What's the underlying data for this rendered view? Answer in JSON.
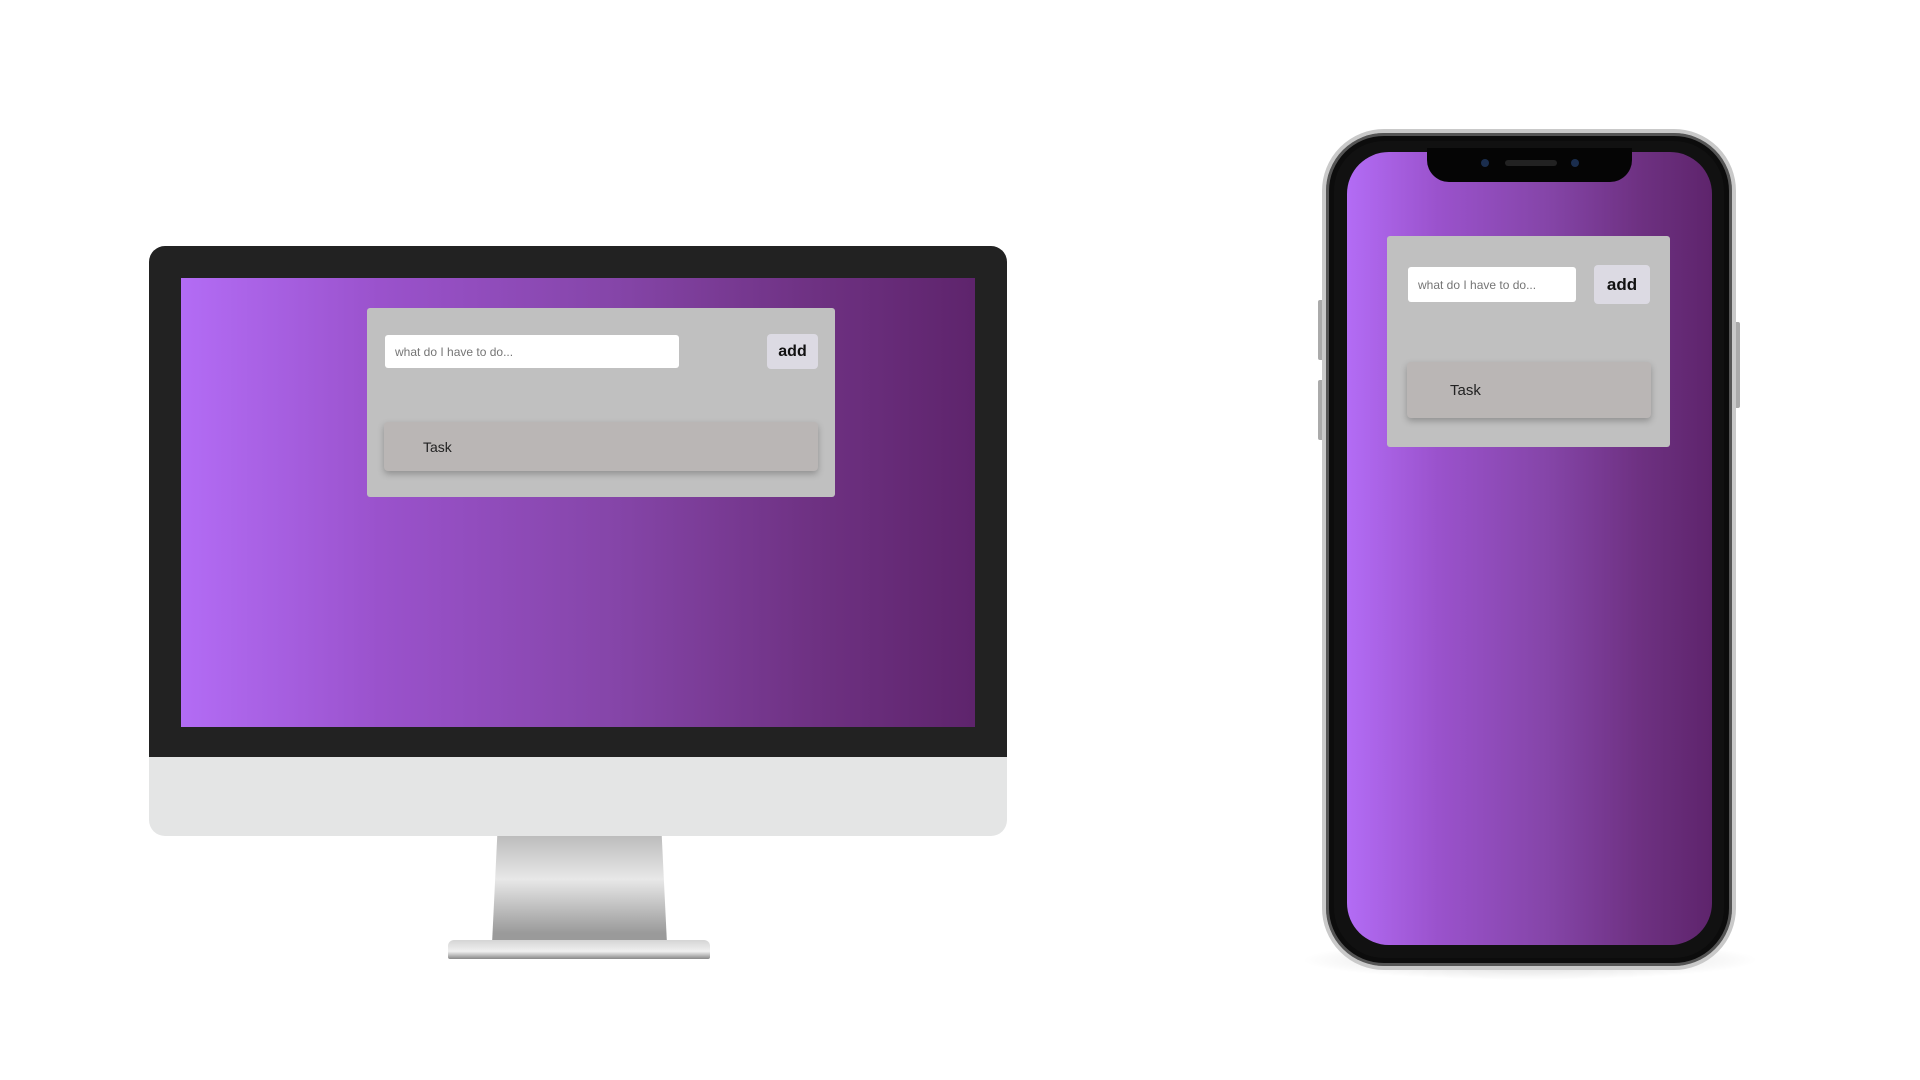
{
  "app": {
    "input_placeholder": "what do I have to do...",
    "add_label": "add",
    "tasks": [
      "Task"
    ]
  },
  "colors": {
    "gradient_start": "#b36cf5",
    "gradient_end": "#5e246c",
    "card": "#c0c0c0",
    "task": "#bab6b5"
  }
}
